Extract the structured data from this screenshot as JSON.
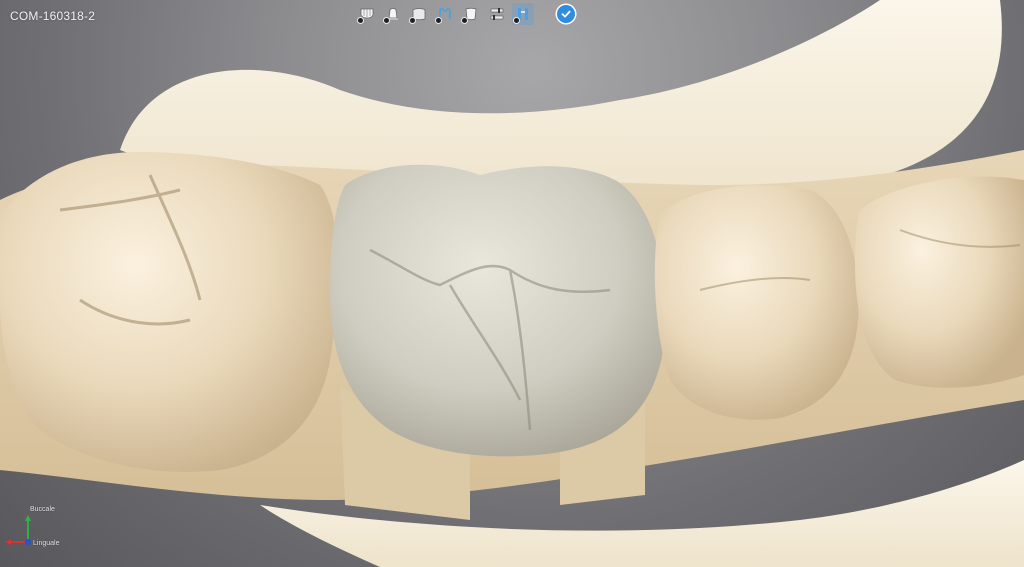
{
  "case": {
    "id": "COM-160318-2"
  },
  "toolbar": {
    "tools": [
      {
        "icon": "upper-jaw-icon",
        "state": "visible"
      },
      {
        "icon": "crown-icon",
        "state": "visible"
      },
      {
        "icon": "gingiva-icon",
        "state": "visible"
      },
      {
        "icon": "preparation-icon",
        "state": "visible"
      },
      {
        "icon": "antagonist-icon",
        "state": "visible"
      },
      {
        "icon": "settings-sliders-icon",
        "state": "visible"
      },
      {
        "icon": "tooth-restoration-icon",
        "state": "active"
      }
    ],
    "confirm_icon": "checkmark-icon"
  },
  "orientation_widget": {
    "top_label": "Buccale",
    "bottom_label": "Linguale",
    "colors": {
      "x_axis": "#e03030",
      "y_axis": "#2fb34a",
      "z_axis": "#2a4fd8"
    }
  },
  "colors": {
    "model_base": "#f3ead7",
    "stone_tooth": "#e8d8bb",
    "crown": "#cfcdc1",
    "accent": "#2f8ce0"
  }
}
